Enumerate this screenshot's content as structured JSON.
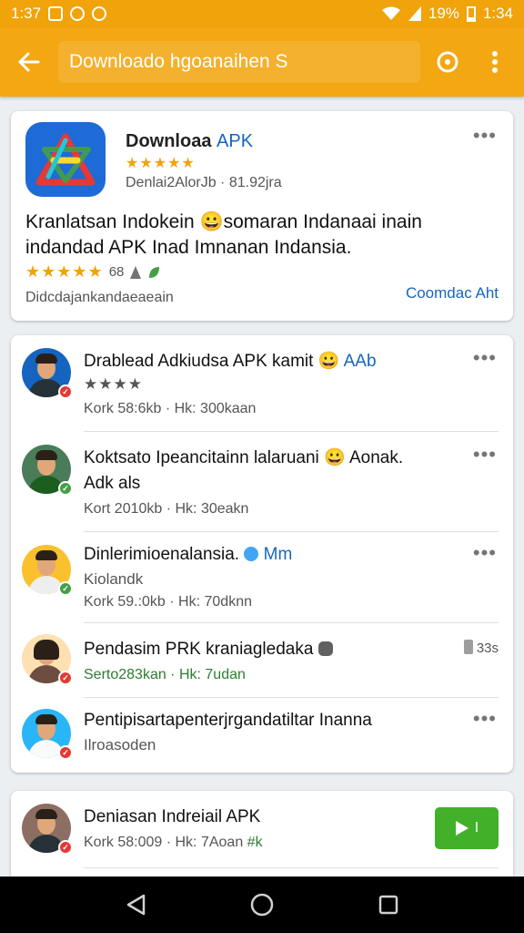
{
  "status_bar": {
    "left_time": "1:37",
    "battery": "19%",
    "time": "1:34"
  },
  "app_bar": {
    "title": "Downloado hgoanaihen S",
    "colors": {
      "bar": "#f3a712",
      "status": "#f0a30a"
    }
  },
  "app_card": {
    "name": "Downloaa",
    "name_accent": "APK",
    "stars": "★★★★★",
    "meta": "Denlai2AlorJb · 81.92jra",
    "description": "Kranlatsan Indokein 😀somaran Indanaai inain indandad APK Inad Imnanan Indansia.",
    "rating_stars": "★★★★★",
    "rating_count": "68",
    "footer_left": "Didcdajankandaeaeain",
    "footer_link": "Coomdac Aht"
  },
  "feed": [
    {
      "title": "Drablead Adkiudsa APK kamit",
      "emoji": "😀",
      "tag": "AAb",
      "sub": "Kork 58:6kb · Hk: 300kaan",
      "stars": "★★★★",
      "badge": "red"
    },
    {
      "title": "Koktsato Ipeancitainn lalaruani",
      "emoji": "😀",
      "tag": "Aonak.",
      "line2": "Adk als",
      "sub": "Kort 2010kb · Hk: 30eakn",
      "badge": "green"
    },
    {
      "title": "Dinlerimioenalansia.",
      "tag": "Mm",
      "line2": "Kiolandk",
      "sub": "Kork 59.:0kb · Hk: 70dknn",
      "badge": "green"
    },
    {
      "title": "Pendasim PRK kraniagledaka",
      "sub": "Serto283kan · Hk: 7udan",
      "side": "33s",
      "badge": "red"
    },
    {
      "title": "Pentipisartapenterjrgandatiltar Inanna",
      "line2": "Ilroasoden",
      "badge": "red"
    }
  ],
  "bottom_card": {
    "title": "Deniasan Indreiail APK",
    "sub": "Kork 58:009 · Hk: 7Aoan",
    "sub_tag": "#k",
    "button_label": "I"
  }
}
